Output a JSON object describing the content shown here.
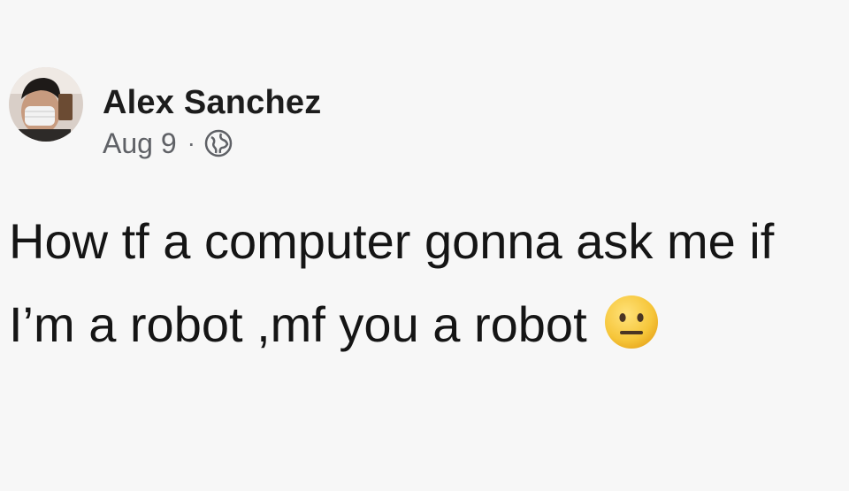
{
  "post": {
    "author": "Alex Sanchez",
    "date": "Aug 9",
    "separator": "·",
    "audience_icon": "globe-icon",
    "text": "How tf a computer gonna ask me if I’m a robot ,mf you a robot",
    "emoji": "neutral-face-emoji"
  },
  "colors": {
    "background": "#f7f7f7",
    "text": "#151515",
    "meta_text": "#5f6166",
    "emoji_yellow": "#f6c63a"
  }
}
